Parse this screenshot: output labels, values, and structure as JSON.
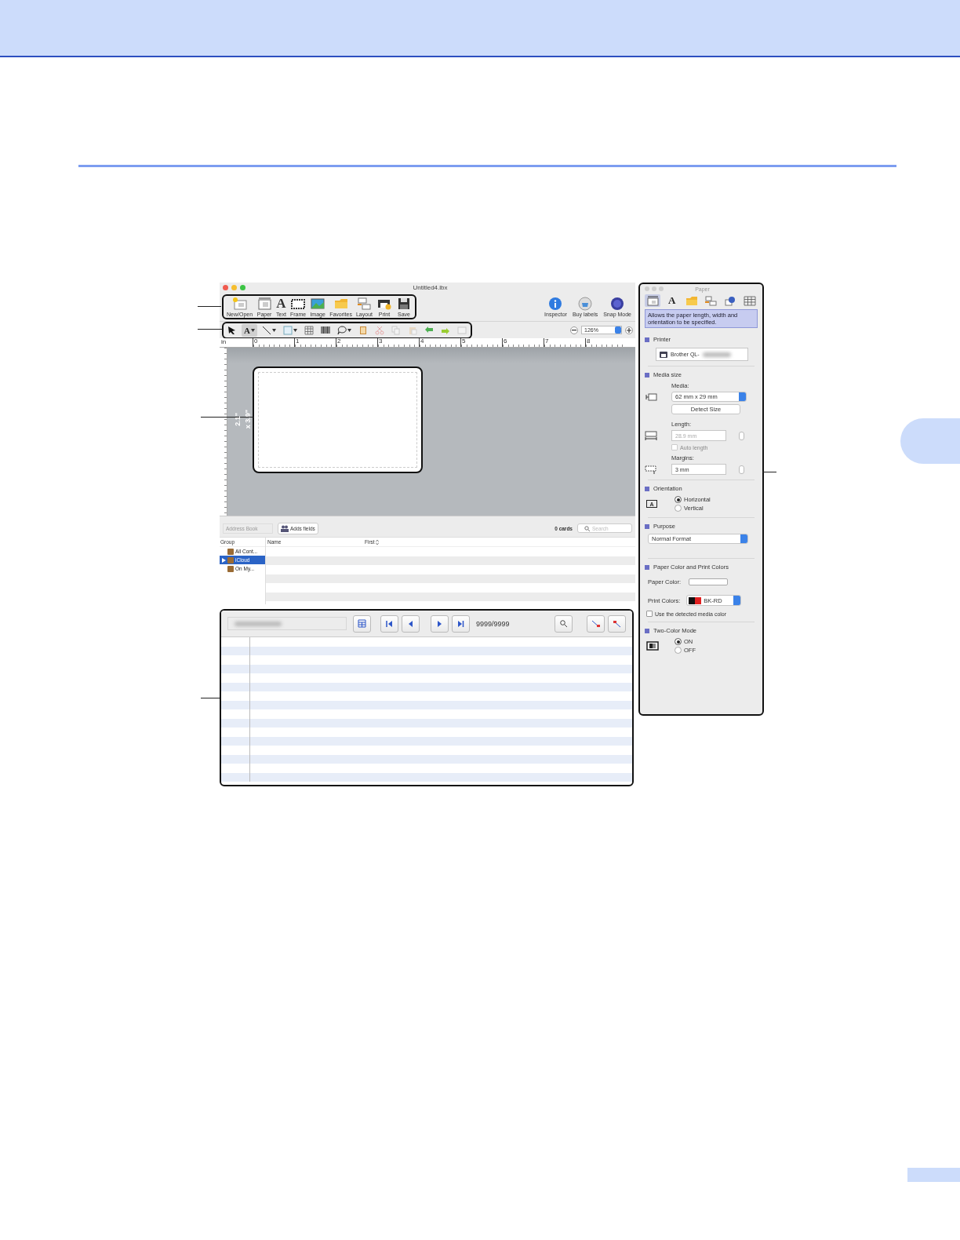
{
  "window": {
    "title": "Untitled4.lbx"
  },
  "main_toolbar": [
    {
      "label": "New/Open",
      "kind": "new-open"
    },
    {
      "label": "Paper",
      "kind": "paper"
    },
    {
      "label": "Text",
      "kind": "text",
      "glyph": "A"
    },
    {
      "label": "Frame",
      "kind": "frame"
    },
    {
      "label": "Image",
      "kind": "image"
    },
    {
      "label": "Favorites",
      "kind": "favorites"
    },
    {
      "label": "Layout",
      "kind": "layout"
    },
    {
      "label": "Print",
      "kind": "print"
    },
    {
      "label": "Save",
      "kind": "save"
    }
  ],
  "right_toolbar": [
    {
      "label": "Inspector",
      "kind": "inspector"
    },
    {
      "label": "Buy labels",
      "kind": "buy"
    },
    {
      "label": "Snap Mode",
      "kind": "snap"
    }
  ],
  "draw_tools": [
    {
      "kind": "pointer",
      "selected": false,
      "menu": false,
      "disabled": false
    },
    {
      "kind": "text",
      "glyph": "A",
      "selected": true,
      "menu": true,
      "disabled": false
    },
    {
      "kind": "line",
      "selected": false,
      "menu": true,
      "disabled": false
    },
    {
      "kind": "shape",
      "selected": false,
      "menu": true,
      "disabled": false
    },
    {
      "kind": "table",
      "selected": false,
      "menu": false,
      "disabled": false
    },
    {
      "kind": "barcode",
      "selected": false,
      "menu": false,
      "disabled": false
    },
    {
      "kind": "clipart",
      "selected": false,
      "menu": true,
      "disabled": false
    },
    {
      "kind": "image",
      "selected": false,
      "menu": false,
      "disabled": false
    },
    {
      "kind": "cut",
      "selected": false,
      "menu": false,
      "disabled": true
    },
    {
      "kind": "copy",
      "selected": false,
      "menu": false,
      "disabled": true
    },
    {
      "kind": "paste",
      "selected": false,
      "menu": false,
      "disabled": true
    },
    {
      "kind": "undo",
      "selected": false,
      "menu": false,
      "disabled": false
    },
    {
      "kind": "redo",
      "selected": false,
      "menu": false,
      "disabled": false
    },
    {
      "kind": "frame",
      "selected": false,
      "menu": false,
      "disabled": true
    }
  ],
  "zoom": {
    "value": "126%"
  },
  "ruler": {
    "unit": "in",
    "labels": [
      "0",
      "1",
      "2",
      "3",
      "4",
      "5",
      "6",
      "7",
      "8"
    ]
  },
  "canvas": {
    "size": [
      "2.1\"",
      "x 3.9\""
    ]
  },
  "address_book": {
    "source": "Address Book",
    "button": "Adds fields",
    "count": "0 cards",
    "search_placeholder": "Search",
    "group_heading": "Group",
    "groups": [
      {
        "label": "All Cont...",
        "selected": false,
        "expandable": false
      },
      {
        "label": "iCloud",
        "selected": true,
        "expandable": true
      },
      {
        "label": "On My...",
        "selected": false,
        "expandable": false
      }
    ],
    "columns": [
      "Name",
      "First"
    ]
  },
  "database": {
    "counter": "9999/9999"
  },
  "inspector": {
    "title": "Paper",
    "tabs": [
      {
        "kind": "paper",
        "selected": true
      },
      {
        "kind": "text",
        "glyph": "A",
        "selected": false
      },
      {
        "kind": "favorites",
        "selected": false
      },
      {
        "kind": "layout",
        "selected": false
      },
      {
        "kind": "object",
        "selected": false
      },
      {
        "kind": "table",
        "selected": false
      }
    ],
    "hint": "Allows the paper length, width and orientation to be specified.",
    "printer": {
      "heading": "Printer",
      "name": "Brother QL-"
    },
    "media": {
      "heading": "Media size",
      "media_label": "Media:",
      "media_value": "62 mm x 29 mm",
      "detect": "Detect Size",
      "length_label": "Length:",
      "length_value": "28.9 mm",
      "length_disabled": true,
      "auto_length": {
        "label": "Auto length",
        "checked": false,
        "disabled": true
      },
      "margins_label": "Margins:",
      "margins_value": "3 mm"
    },
    "orientation": {
      "heading": "Orientation",
      "glyph": "A",
      "options": [
        {
          "label": "Horizontal",
          "selected": true
        },
        {
          "label": "Vertical",
          "selected": false
        }
      ]
    },
    "purpose": {
      "heading": "Purpose",
      "value": "Normal Format"
    },
    "colors": {
      "heading": "Paper Color and Print Colors",
      "paper_label": "Paper Color:",
      "print_label": "Print Colors:",
      "print_value": "BK-RD",
      "detected": {
        "label": "Use the detected media color",
        "checked": false
      }
    },
    "two_color": {
      "heading": "Two-Color Mode",
      "options": [
        {
          "label": "ON",
          "selected": true
        },
        {
          "label": "OFF",
          "selected": false
        }
      ]
    }
  }
}
